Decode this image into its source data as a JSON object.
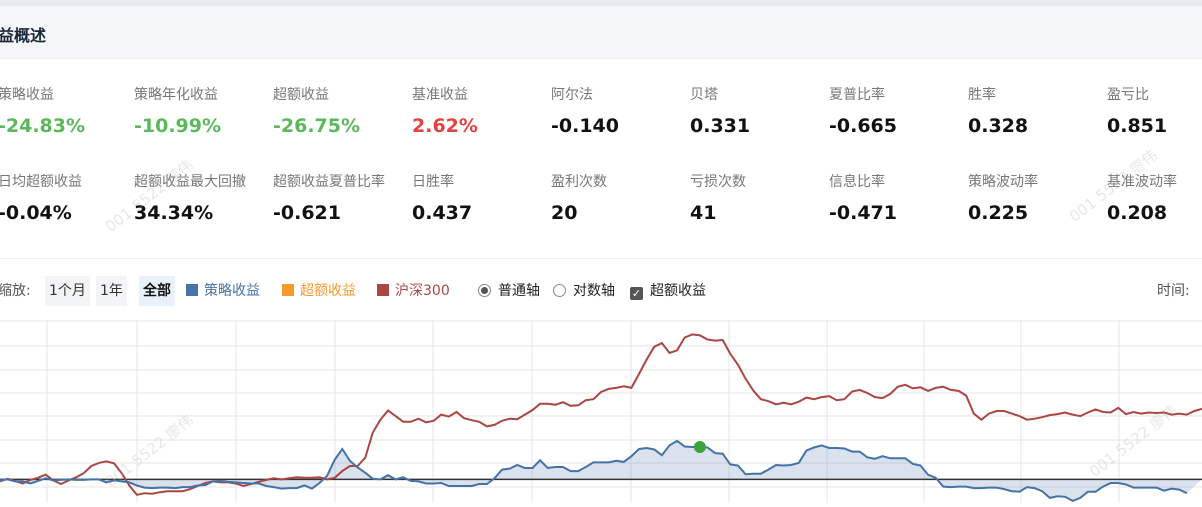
{
  "section": {
    "title": "益概述"
  },
  "metrics": [
    {
      "label": "策略收益",
      "value": "-24.83%",
      "tone": "green"
    },
    {
      "label": "策略年化收益",
      "value": "-10.99%",
      "tone": "green"
    },
    {
      "label": "超额收益",
      "value": "-26.75%",
      "tone": "green"
    },
    {
      "label": "基准收益",
      "value": "2.62%",
      "tone": "red"
    },
    {
      "label": "阿尔法",
      "value": "-0.140",
      "tone": ""
    },
    {
      "label": "贝塔",
      "value": "0.331",
      "tone": ""
    },
    {
      "label": "夏普比率",
      "value": "-0.665",
      "tone": ""
    },
    {
      "label": "胜率",
      "value": "0.328",
      "tone": ""
    },
    {
      "label": "盈亏比",
      "value": "0.851",
      "tone": ""
    },
    {
      "label": "日均超额收益",
      "value": "-0.04%",
      "tone": ""
    },
    {
      "label": "超额收益最大回撤",
      "value": "34.34%",
      "tone": ""
    },
    {
      "label": "超额收益夏普比率",
      "value": "-0.621",
      "tone": ""
    },
    {
      "label": "日胜率",
      "value": "0.437",
      "tone": ""
    },
    {
      "label": "盈利次数",
      "value": "20",
      "tone": ""
    },
    {
      "label": "亏损次数",
      "value": "41",
      "tone": ""
    },
    {
      "label": "信息比率",
      "value": "-0.471",
      "tone": ""
    },
    {
      "label": "策略波动率",
      "value": "0.225",
      "tone": ""
    },
    {
      "label": "基准波动率",
      "value": "0.208",
      "tone": ""
    }
  ],
  "controls": {
    "zoom_label": "缩放:",
    "zoom_1m": "1个月",
    "zoom_1y": "1年",
    "zoom_all": "全部",
    "legend_strategy": "策略收益",
    "legend_excess": "超额收益",
    "legend_benchmark": "沪深300",
    "axis_normal": "普通轴",
    "axis_log": "对数轴",
    "excess_toggle": "超额收益",
    "time_label": "时间:"
  },
  "watermarks": [
    "001 5522 廖伟",
    "001 5522 廖伟",
    "001 5522 廖伟"
  ],
  "colors": {
    "strategy": "#4572a7",
    "excess": "#f79a2e",
    "benchmark": "#aa4643",
    "positive": "#5cb85c",
    "negative": "#e04343"
  },
  "chart_data": {
    "type": "line",
    "series": [
      {
        "name": "沪深300",
        "values": [
          -0.4,
          0.1,
          -0.3,
          -0.8,
          -0.1,
          0.3,
          0.9,
          -0.2,
          -0.9,
          -0.2,
          0.4,
          1.2,
          2.6,
          3.2,
          3.5,
          3.1,
          1.2,
          -1.2,
          -3.0,
          -2.7,
          -2.8,
          -2.5,
          -2.3,
          -2.3,
          -2.3,
          -1.9,
          -1.3,
          -0.7,
          -0.4,
          -0.6,
          -0.6,
          -0.8,
          -1.3,
          -0.9,
          -0.5,
          -0.1,
          0.2,
          0.0,
          0.2,
          0.4,
          0.3,
          0.3,
          0.4,
          0.0,
          0.3,
          1.6,
          2.6,
          2.6,
          4.2,
          9.1,
          11.6,
          13.4,
          12.3,
          11.2,
          11.2,
          11.8,
          11.1,
          11.4,
          12.6,
          12.2,
          13.1,
          11.9,
          11.5,
          11.2,
          10.3,
          10.6,
          11.4,
          11.8,
          11.7,
          12.6,
          13.5,
          14.7,
          14.7,
          14.5,
          15.0,
          14.3,
          14.4,
          15.4,
          15.6,
          17.0,
          17.6,
          17.8,
          18.1,
          17.8,
          20.5,
          23.3,
          25.8,
          26.5,
          24.6,
          25.1,
          27.6,
          28.2,
          28.0,
          27.2,
          27.0,
          27.1,
          24.4,
          22.3,
          19.6,
          17.3,
          15.6,
          15.2,
          14.6,
          14.9,
          14.6,
          15.1,
          15.9,
          15.6,
          16.0,
          16.2,
          15.4,
          15.6,
          17.1,
          17.4,
          16.8,
          16.0,
          15.8,
          16.6,
          18.0,
          18.4,
          17.7,
          17.9,
          17.2,
          17.8,
          18.0,
          17.4,
          17.2,
          16.3,
          12.8,
          11.6,
          12.8,
          13.3,
          13.3,
          12.8,
          12.3,
          11.6,
          11.8,
          12.1,
          12.5,
          12.7,
          13.0,
          12.6,
          12.3,
          13.0,
          13.6,
          13.1,
          13.0,
          13.9,
          12.7,
          13.1,
          12.8,
          13.0,
          12.9,
          13.0,
          12.6,
          12.8,
          12.6,
          13.3,
          13.7
        ]
      },
      {
        "name": "策略收益",
        "values": [
          -0.2,
          0.0,
          -0.4,
          -0.4,
          -0.8,
          -0.3,
          0.2,
          -0.2,
          -0.1,
          0.0,
          -0.1,
          -0.1,
          0.0,
          0.0,
          -0.6,
          -0.2,
          -0.4,
          -0.6,
          -1.2,
          -1.6,
          -1.7,
          -1.6,
          -1.6,
          -1.7,
          -1.5,
          -1.5,
          -1.2,
          -1.1,
          -0.4,
          -0.3,
          -0.5,
          -0.6,
          -0.7,
          -0.8,
          -0.8,
          -1.3,
          -1.5,
          -1.8,
          -1.7,
          -1.7,
          -1.2,
          -1.8,
          -0.7,
          0.7,
          3.8,
          5.9,
          3.6,
          2.3,
          1.3,
          0.1,
          0.0,
          0.8,
          0.0,
          0.4,
          -0.3,
          -0.4,
          -0.8,
          -0.8,
          -0.7,
          -1.3,
          -1.3,
          -1.3,
          -1.3,
          -0.9,
          -0.9,
          0.2,
          1.9,
          2.1,
          2.8,
          2.2,
          2.2,
          3.7,
          2.2,
          2.4,
          2.4,
          1.6,
          1.6,
          2.4,
          3.3,
          3.3,
          3.3,
          3.6,
          3.4,
          4.5,
          5.9,
          6.1,
          5.8,
          4.7,
          6.6,
          7.5,
          6.4,
          6.3,
          6.3,
          6.2,
          5.1,
          5.0,
          2.9,
          2.7,
          1.0,
          1.1,
          1.1,
          1.9,
          2.8,
          2.7,
          2.8,
          3.2,
          5.6,
          6.2,
          6.6,
          6.1,
          6.1,
          6.0,
          5.4,
          5.4,
          4.3,
          4.0,
          4.5,
          4.1,
          4.1,
          4.1,
          3.0,
          2.7,
          0.9,
          0.3,
          -1.4,
          -1.5,
          -1.4,
          -1.4,
          -1.7,
          -1.7,
          -1.6,
          -1.6,
          -1.9,
          -2.3,
          -2.4,
          -1.5,
          -1.7,
          -2.3,
          -3.6,
          -3.3,
          -3.4,
          -4.2,
          -3.6,
          -2.4,
          -2.4,
          -1.4,
          -0.7,
          -0.7,
          -1.0,
          -1.6,
          -1.6,
          -1.6,
          -1.6,
          -2.2,
          -1.8,
          -2.0,
          -2.7
        ]
      }
    ],
    "highlight_point": {
      "series": "策略收益",
      "index": 92,
      "marker": "green-dot"
    },
    "baseline": 0,
    "ylim": [
      -4.6,
      31
    ],
    "grid": true
  }
}
